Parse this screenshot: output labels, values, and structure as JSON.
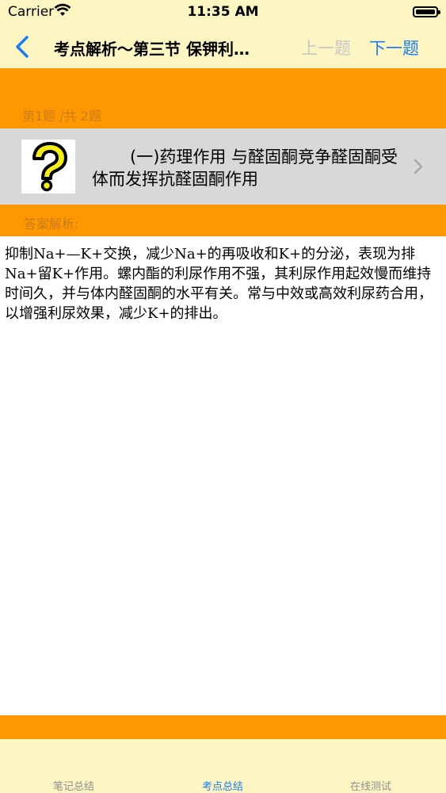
{
  "status": {
    "carrier": "Carrier",
    "time": "11:35 AM"
  },
  "nav": {
    "title": "考点解析～第三节 保钾利…",
    "prev_label": "上一题",
    "next_label": "下一题"
  },
  "question": {
    "counter": "第1题 /共 2题",
    "text": "(一)药理作用 与醛固酮竞争醛固酮受体而发挥抗醛固酮作用",
    "icon": "question-mark-icon"
  },
  "answer": {
    "label": "答案解析:",
    "text": "抑制Na+—K+交换，减少Na+的再吸收和K+的分泌，表现为排Na+留K+作用。螺内酯的利尿作用不强，其利尿作用起效慢而维持时间久，并与体内醛固酮的水平有关。常与中效或高效利尿药合用，以增强利尿效果，减少K+的排出。"
  },
  "tabs": [
    {
      "label": "笔记总结"
    },
    {
      "label": "考点总结"
    },
    {
      "label": "在线测试"
    }
  ],
  "colors": {
    "accent": "#1a7cf0",
    "orange": "#fe9702",
    "cream": "#fdf6c3",
    "gray_row": "#d8d8d8"
  }
}
